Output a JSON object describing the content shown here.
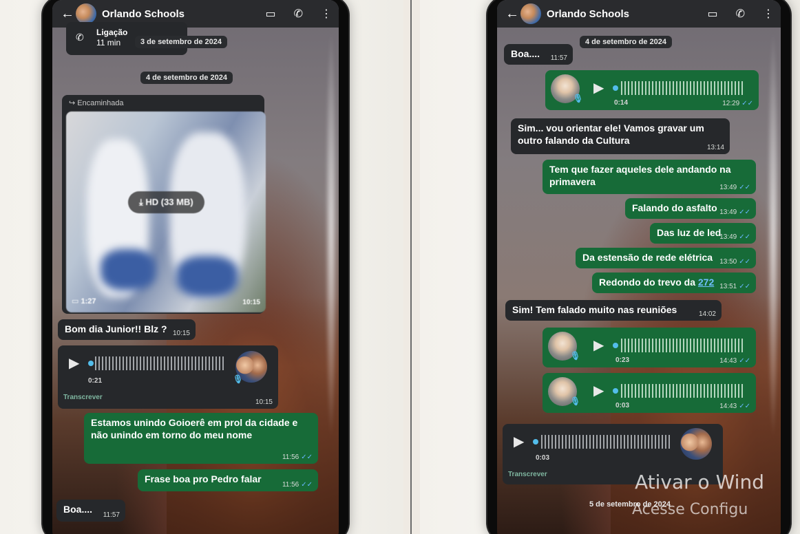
{
  "left": {
    "header": {
      "contact": "Orlando Schools",
      "back": "←",
      "video": "▭",
      "call": "✆",
      "menu": "⋮"
    },
    "call_log": {
      "title": "Ligação",
      "duration": "11 min",
      "date": "3 de setembro de 2024"
    },
    "date_chip": "4 de setembro de 2024",
    "forwarded_label": "Encaminhada",
    "video_media": {
      "hd_label": "HD (33 MB)",
      "length": "1:27",
      "time": "10:15"
    },
    "messages": [
      {
        "text": "Bom dia Junior!! Blz ?",
        "time": "10:15"
      },
      {
        "text": "Estamos unindo Goioerê em prol da cidade e não unindo em torno do meu nome",
        "time": "11:56"
      },
      {
        "text": "Frase boa pro Pedro falar",
        "time": "11:56"
      },
      {
        "text": "Boa....",
        "time": "11:57"
      }
    ],
    "voice": {
      "duration": "0:21",
      "time": "10:15",
      "transcribe": "Transcrever"
    }
  },
  "right": {
    "header": {
      "contact": "Orlando Schools"
    },
    "date_chip": "4 de setembro de 2024",
    "date_chip_bottom": "5 de setembro de 2024",
    "messages": [
      {
        "text": "Boa....",
        "time": "11:57"
      },
      {
        "text": "Sim... vou orientar ele!  Vamos gravar um outro falando da Cultura",
        "time": "13:14"
      },
      {
        "text": "Tem que fazer aqueles dele andando na primavera",
        "time": "13:49"
      },
      {
        "text": "Falando do asfalto",
        "time": "13:49"
      },
      {
        "text": "Das luz de led",
        "time": "13:49"
      },
      {
        "text": "Da estensão de rede elétrica",
        "time": "13:50"
      },
      {
        "text": "Redondo do trevo da",
        "link": "272",
        "time": "13:51"
      },
      {
        "text": "Sim! Tem falado muito nas reuniões",
        "time": "14:02"
      }
    ],
    "voices": [
      {
        "duration": "0:14",
        "time": "12:29"
      },
      {
        "duration": "0:23",
        "time": "14:43"
      },
      {
        "duration": "0:03",
        "time": "14:43"
      },
      {
        "duration": "0:03",
        "transcribe": "Transcrever"
      }
    ],
    "watermark": {
      "line1": "Ativar o Wind",
      "line2": "Acesse Configu"
    }
  }
}
